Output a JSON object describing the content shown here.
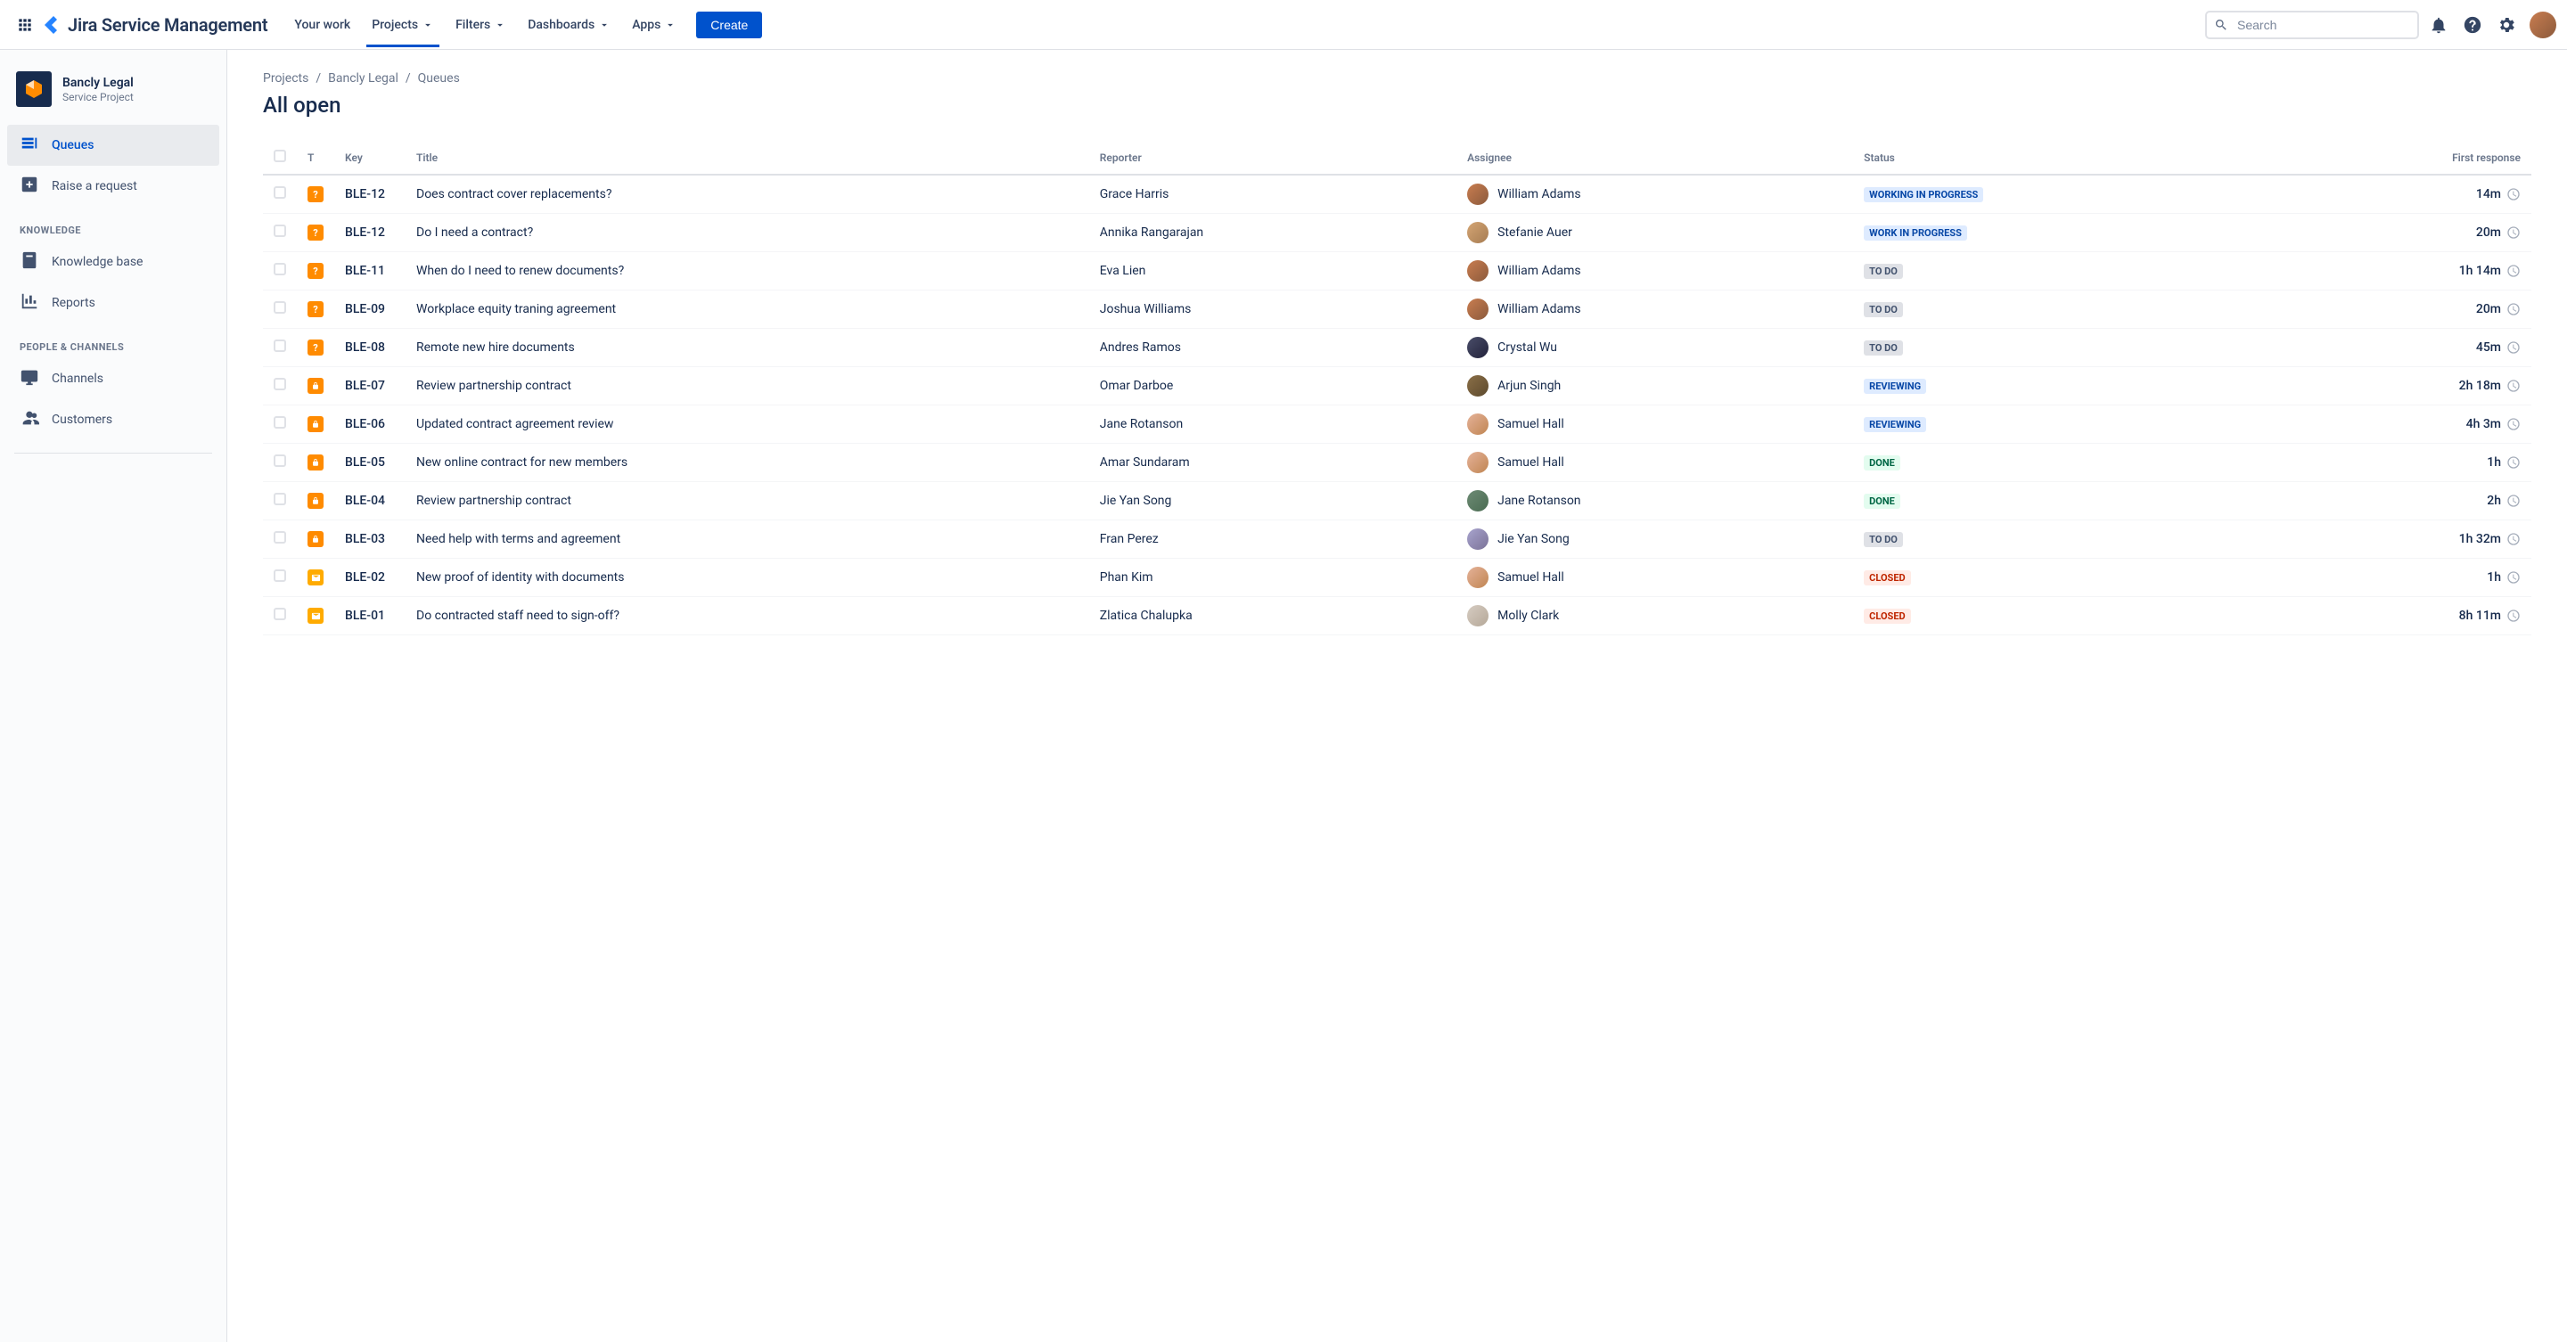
{
  "nav": {
    "product_name": "Jira Service Management",
    "items": [
      "Your work",
      "Projects",
      "Filters",
      "Dashboards",
      "Apps"
    ],
    "active_index": 1,
    "create_label": "Create",
    "search_placeholder": "Search"
  },
  "sidebar": {
    "project_name": "Bancly Legal",
    "project_type": "Service Project",
    "items": [
      {
        "label": "Queues",
        "icon": "queues"
      },
      {
        "label": "Raise a request",
        "icon": "plus-box"
      }
    ],
    "sections": [
      {
        "title": "KNOWLEDGE",
        "items": [
          {
            "label": "Knowledge base",
            "icon": "book"
          },
          {
            "label": "Reports",
            "icon": "chart"
          }
        ]
      },
      {
        "title": "PEOPLE & CHANNELS",
        "items": [
          {
            "label": "Channels",
            "icon": "monitor"
          },
          {
            "label": "Customers",
            "icon": "people"
          }
        ]
      }
    ]
  },
  "breadcrumb": [
    "Projects",
    "Bancly Legal",
    "Queues"
  ],
  "page_title": "All open",
  "table": {
    "columns": [
      "",
      "T",
      "Key",
      "Title",
      "Reporter",
      "Assignee",
      "Status",
      "First response"
    ],
    "rows": [
      {
        "type": "question",
        "key": "BLE-12",
        "title": "Does contract cover replacements?",
        "reporter": "Grace Harris",
        "assignee": "William Adams",
        "avatar": "av-1",
        "status": "WORKING IN PROGRESS",
        "status_class": "inprogress",
        "response": "14m"
      },
      {
        "type": "question",
        "key": "BLE-12",
        "title": "Do I need a contract?",
        "reporter": "Annika Rangarajan",
        "assignee": "Stefanie Auer",
        "avatar": "av-2",
        "status": "WORK IN PROGRESS",
        "status_class": "inprogress",
        "response": "20m"
      },
      {
        "type": "question",
        "key": "BLE-11",
        "title": "When do I need to renew documents?",
        "reporter": "Eva Lien",
        "assignee": "William Adams",
        "avatar": "av-1",
        "status": "TO DO",
        "status_class": "default",
        "response": "1h 14m"
      },
      {
        "type": "question",
        "key": "BLE-09",
        "title": "Workplace equity traning agreement",
        "reporter": "Joshua Williams",
        "assignee": "William Adams",
        "avatar": "av-1",
        "status": "TO DO",
        "status_class": "default",
        "response": "20m"
      },
      {
        "type": "question",
        "key": "BLE-08",
        "title": "Remote new hire documents",
        "reporter": "Andres Ramos",
        "assignee": "Crystal Wu",
        "avatar": "av-3",
        "status": "TO DO",
        "status_class": "default",
        "response": "45m"
      },
      {
        "type": "lock",
        "key": "BLE-07",
        "title": "Review partnership contract",
        "reporter": "Omar Darboe",
        "assignee": "Arjun Singh",
        "avatar": "av-4",
        "status": "REVIEWING",
        "status_class": "inprogress",
        "response": "2h 18m"
      },
      {
        "type": "lock",
        "key": "BLE-06",
        "title": "Updated contract agreement review",
        "reporter": "Jane Rotanson",
        "assignee": "Samuel Hall",
        "avatar": "av-5",
        "status": "REVIEWING",
        "status_class": "inprogress",
        "response": "4h 3m"
      },
      {
        "type": "lock",
        "key": "BLE-05",
        "title": "New online contract for new members",
        "reporter": "Amar Sundaram",
        "assignee": "Samuel Hall",
        "avatar": "av-5",
        "status": "DONE",
        "status_class": "done",
        "response": "1h"
      },
      {
        "type": "lock",
        "key": "BLE-04",
        "title": "Review partnership contract",
        "reporter": "Jie Yan Song",
        "assignee": "Jane Rotanson",
        "avatar": "av-6",
        "status": "DONE",
        "status_class": "done",
        "response": "2h"
      },
      {
        "type": "lock",
        "key": "BLE-03",
        "title": "Need help with terms and agreement",
        "reporter": "Fran Perez",
        "assignee": "Jie Yan Song",
        "avatar": "av-7",
        "status": "TO DO",
        "status_class": "default",
        "response": "1h 32m"
      },
      {
        "type": "mail",
        "key": "BLE-02",
        "title": "New proof of identity with documents",
        "reporter": "Phan Kim",
        "assignee": "Samuel Hall",
        "avatar": "av-5",
        "status": "CLOSED",
        "status_class": "closed",
        "response": "1h"
      },
      {
        "type": "mail",
        "key": "BLE-01",
        "title": "Do contracted staff need to sign-off?",
        "reporter": "Zlatica Chalupka",
        "assignee": "Molly Clark",
        "avatar": "av-8",
        "status": "CLOSED",
        "status_class": "closed",
        "response": "8h 11m"
      }
    ]
  }
}
